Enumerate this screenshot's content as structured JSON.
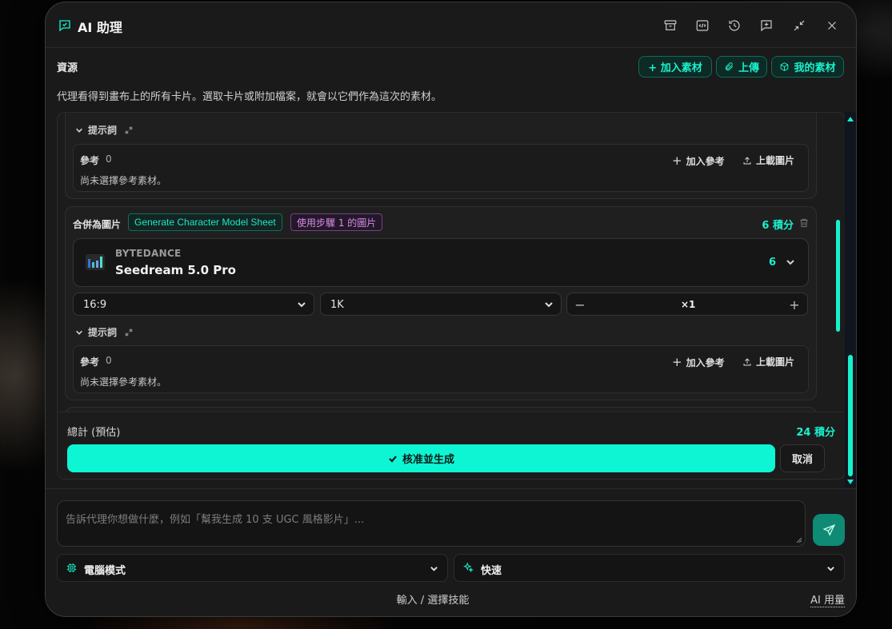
{
  "header": {
    "title": "AI 助理",
    "icons": [
      "archive-icon",
      "code-icon",
      "history-icon",
      "new-chat-icon",
      "minimize-icon",
      "close-icon"
    ]
  },
  "resources": {
    "label": "資源",
    "description": "代理看得到畫布上的所有卡片。選取卡片或附加檔案，就會以它們作為這次的素材。",
    "add_material": "+ 加入素材",
    "upload": "上傳",
    "my_materials": "我的素材"
  },
  "step_top": {
    "prompt_label": "提示詞",
    "ref_label": "參考",
    "ref_count": "0",
    "ref_empty": "尚未選擇參考素材。",
    "add_ref": "加入參考",
    "upload_image": "上載圖片"
  },
  "step_merge": {
    "label": "合併為圖片",
    "tag_action": "Generate Character Model Sheet",
    "tag_source": "使用步驟 1 的圖片",
    "credits": "6 積分",
    "model_vendor": "BYTEDANCE",
    "model_name": "Seedream 5.0 Pro",
    "model_credits": "6",
    "aspect_ratio": "16:9",
    "resolution": "1K",
    "minus": "−",
    "quantity": "×1",
    "plus": "+",
    "prompt_label": "提示詞",
    "ref_label": "參考",
    "ref_count": "0",
    "ref_empty": "尚未選擇參考素材。",
    "add_ref": "加入參考",
    "upload_image": "上載圖片"
  },
  "summary": {
    "total_label": "總計 (預估)",
    "total_value": "24 積分",
    "approve": "核准並生成",
    "cancel": "取消"
  },
  "composer": {
    "placeholder": "告訴代理你想做什麼，例如「幫我生成 10 支 UGC 風格影片」...",
    "mode": "電腦模式",
    "speed": "快速",
    "skills_hint": "輸入 / 選擇技能",
    "usage": "AI 用量"
  },
  "colors": {
    "accent": "#19f0cc",
    "approve_bg": "#0ef5d3",
    "send_bg": "#0f8a74",
    "purple_tag": "#d98be6",
    "panel_bg": "#1a1a1a"
  }
}
